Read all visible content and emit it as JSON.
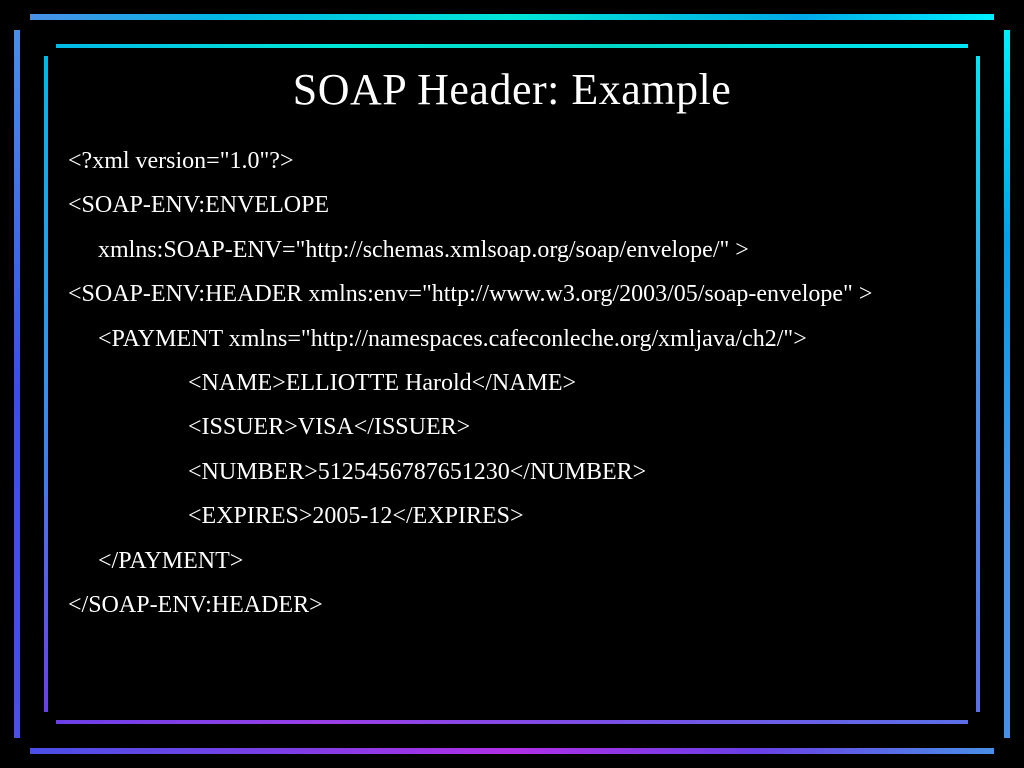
{
  "slide": {
    "title": "SOAP Header: Example",
    "lines": {
      "l1": "<?xml version=\"1.0\"?>",
      "l2": "<SOAP-ENV:ENVELOPE",
      "l3": "xmlns:SOAP-ENV=\"http://schemas.xmlsoap.org/soap/envelope/\" >",
      "l4": "<SOAP-ENV:HEADER xmlns:env=\"http://www.w3.org/2003/05/soap-envelope\" >",
      "l5": "<PAYMENT xmlns=\"http://namespaces.cafeconleche.org/xmljava/ch2/\">",
      "l6": "<NAME>ELLIOTTE Harold</NAME>",
      "l7": "<ISSUER>VISA</ISSUER>",
      "l8": "<NUMBER>5125456787651230</NUMBER>",
      "l9": "<EXPIRES>2005-12</EXPIRES>",
      "l10": "</PAYMENT>",
      "l11": "</SOAP-ENV:HEADER>"
    }
  }
}
